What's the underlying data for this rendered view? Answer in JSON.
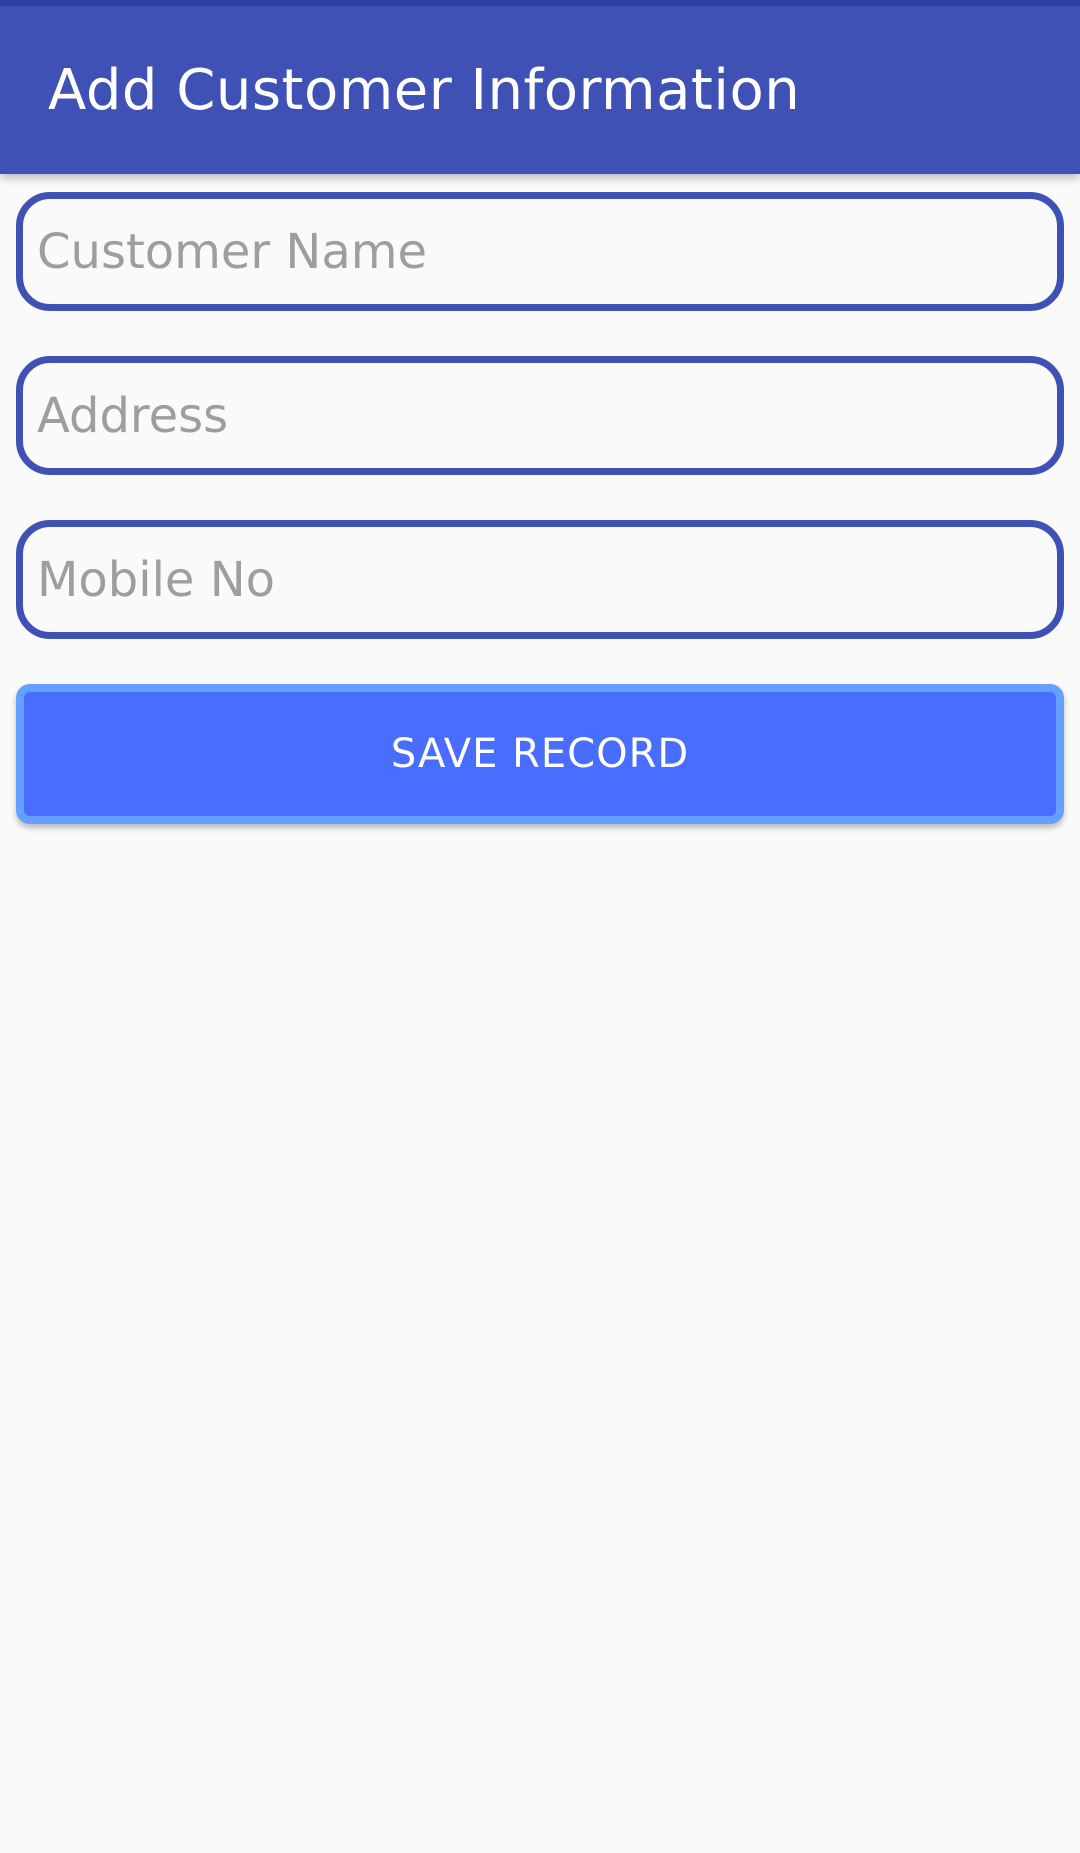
{
  "app_bar": {
    "title": "Add Customer Information",
    "color": "#3f51b5"
  },
  "form": {
    "customer_name": {
      "placeholder": "Customer Name",
      "value": ""
    },
    "address": {
      "placeholder": "Address",
      "value": ""
    },
    "mobile_no": {
      "placeholder": "Mobile No",
      "value": ""
    }
  },
  "save_button": {
    "label": "SAVE RECORD",
    "color": "#486dff"
  }
}
